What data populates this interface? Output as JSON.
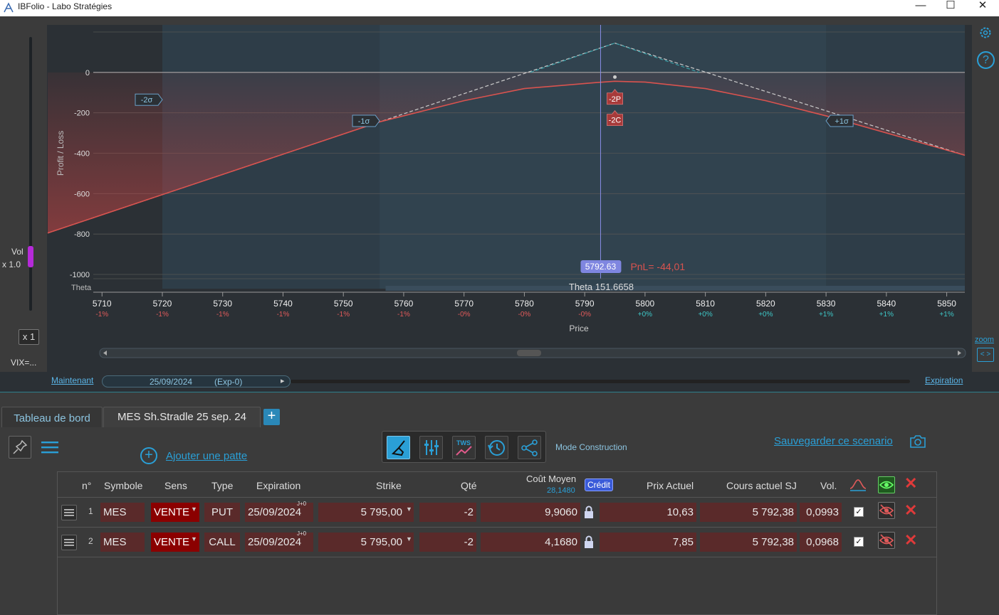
{
  "window": {
    "title": "IBFolio - Labo Stratégies",
    "minimize": "—",
    "maximize": "☐",
    "close": "✕"
  },
  "left_controls": {
    "vol_label": "Vol",
    "vol_value": "x 1.0",
    "vol_level": 1.0,
    "multiplier": "x 1",
    "vix": "VIX=..."
  },
  "right_controls": {
    "help": "?",
    "zoom": "zoom",
    "zoom_btn": "< >"
  },
  "chart_data": {
    "type": "line",
    "ylabel": "Profit / Loss",
    "xlabel": "Price",
    "xlim": [
      5701,
      5853
    ],
    "ylim": [
      -1000,
      200
    ],
    "yticks": [
      0,
      -200,
      -400,
      -600,
      -800,
      -1000
    ],
    "xticks": [
      {
        "v": 5710,
        "pct": "-1%"
      },
      {
        "v": 5720,
        "pct": "-1%"
      },
      {
        "v": 5730,
        "pct": "-1%"
      },
      {
        "v": 5740,
        "pct": "-1%"
      },
      {
        "v": 5750,
        "pct": "-1%"
      },
      {
        "v": 5760,
        "pct": "-1%"
      },
      {
        "v": 5770,
        "pct": "-0%"
      },
      {
        "v": 5780,
        "pct": "-0%"
      },
      {
        "v": 5790,
        "pct": "-0%"
      },
      {
        "v": 5800,
        "pct": "+0%"
      },
      {
        "v": 5810,
        "pct": "+0%"
      },
      {
        "v": 5820,
        "pct": "+0%"
      },
      {
        "v": 5830,
        "pct": "+1%"
      },
      {
        "v": 5840,
        "pct": "+1%"
      },
      {
        "v": 5850,
        "pct": "+1%"
      }
    ],
    "series": [
      {
        "points": [
          [
            5701,
            -795
          ],
          [
            5756,
            -245
          ],
          [
            5770,
            -140
          ],
          [
            5780,
            -80
          ],
          [
            5792,
            -50
          ],
          [
            5795,
            -44
          ],
          [
            5800,
            -48
          ],
          [
            5810,
            -80
          ],
          [
            5820,
            -140
          ],
          [
            5830,
            -215
          ],
          [
            5853,
            -410
          ]
        ]
      },
      {
        "points": [
          [
            5701,
            -795
          ],
          [
            5795,
            145
          ],
          [
            5853,
            -410
          ]
        ]
      },
      {
        "points": [
          [
            5795,
            -44
          ]
        ]
      }
    ],
    "sigma_bands": [
      {
        "label": "-2σ",
        "x": 5720
      },
      {
        "label": "-1σ",
        "x": 5756
      },
      {
        "label": "+1σ",
        "x": 5830
      }
    ],
    "sigma_end": 5853,
    "current_price": {
      "value": "5792.63",
      "x": 5792.63
    },
    "pnl_label": "PnL= -44,01",
    "strike_markers": [
      {
        "label": "-2P",
        "x": 5795,
        "y": -130
      },
      {
        "label": "-2C",
        "x": 5795,
        "y": -235
      }
    ],
    "theta_label": "Theta",
    "theta_value": "Theta 151.6658",
    "colors": {
      "pnl": "#d9534f",
      "expiry": "#3aa0a8",
      "price": "#8a8fe8"
    }
  },
  "timebar": {
    "now": "Maintenant",
    "date": "25/09/2024",
    "exp": "(Exp-0)",
    "arrow": "▸",
    "expiration": "Expiration"
  },
  "tabs": [
    {
      "label": "Tableau de bord"
    },
    {
      "label": "MES Sh.Stradle 25 sep. 24"
    }
  ],
  "tab_add": "+",
  "toolbar": {
    "add_leg": "Ajouter une patte",
    "add_icon": "+",
    "mode": "Mode Construction",
    "save": "Sauvegarder ce scenario",
    "tws": "TWS"
  },
  "table": {
    "headers": {
      "n": "n°",
      "symbole": "Symbole",
      "sens": "Sens",
      "type": "Type",
      "expiration": "Expiration",
      "strike": "Strike",
      "qte": "Qté",
      "cout": "Coût Moyen",
      "cout_sub": "28,1480",
      "credit": "Crédit",
      "prix": "Prix Actuel",
      "cours": "Cours actuel SJ",
      "vol": "Vol."
    },
    "rows": [
      {
        "n": "1",
        "symbole": "MES",
        "sens": "VENTE",
        "type": "PUT",
        "jtag": "J+0",
        "expiration": "25/09/2024",
        "strike": "5 795,00",
        "qte": "-2",
        "cout": "9,9060",
        "prix": "10,63",
        "cours": "5 792,38",
        "vol": "0,0993",
        "checked": "✓"
      },
      {
        "n": "2",
        "symbole": "MES",
        "sens": "VENTE",
        "type": "CALL",
        "jtag": "J+0",
        "expiration": "25/09/2024",
        "strike": "5 795,00",
        "qte": "-2",
        "cout": "4,1680",
        "prix": "7,85",
        "cours": "5 792,38",
        "vol": "0,0968",
        "checked": "✓"
      }
    ]
  }
}
